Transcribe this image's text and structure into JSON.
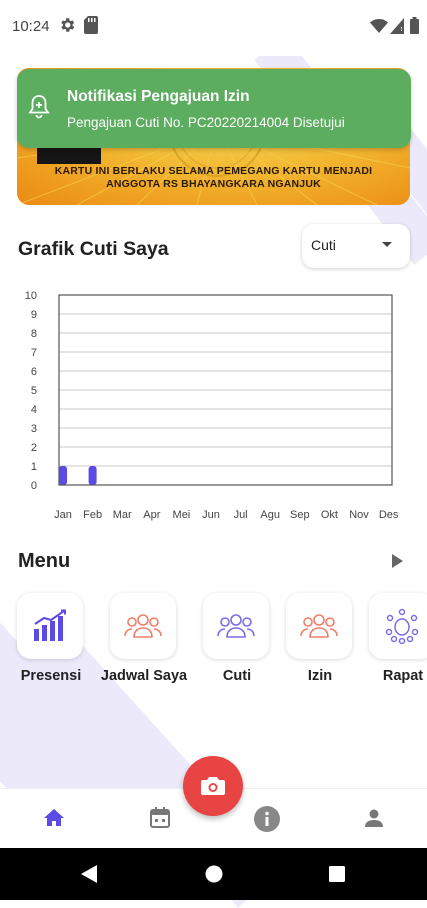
{
  "status_bar": {
    "time": "10:24"
  },
  "id_card": {
    "text_line_1": "KARTU INI BERLAKU SELAMA PEMEGANG KARTU MENJADI",
    "text_line_2": "ANGGOTA RS BHAYANGKARA NGANJUK"
  },
  "notification": {
    "title": "Notifikasi Pengajuan Izin",
    "body": "Pengajuan Cuti No. PC20220214004 Disetujui"
  },
  "chart_section": {
    "title": "Grafik Cuti Saya",
    "dropdown_value": "Cuti"
  },
  "chart_data": {
    "type": "bar",
    "categories": [
      "Jan",
      "Feb",
      "Mar",
      "Apr",
      "Mei",
      "Jun",
      "Jul",
      "Agu",
      "Sep",
      "Okt",
      "Nov",
      "Des"
    ],
    "values": [
      1,
      1,
      0,
      0,
      0,
      0,
      0,
      0,
      0,
      0,
      0,
      0
    ],
    "ylim": [
      0,
      10
    ],
    "yticks": [
      "0",
      "1",
      "2",
      "3",
      "4",
      "5",
      "6",
      "7",
      "8",
      "9",
      "10"
    ],
    "grid": true,
    "bar_color": "#5b4be6"
  },
  "menu": {
    "title": "Menu",
    "items": [
      {
        "label": "Presensi",
        "icon": "bar-chart-icon"
      },
      {
        "label": "Jadwal Saya",
        "icon": "group-icon"
      },
      {
        "label": "Cuti",
        "icon": "group-icon"
      },
      {
        "label": "Izin",
        "icon": "group-icon"
      },
      {
        "label": "Rapat",
        "icon": "meeting-icon"
      }
    ]
  },
  "bottom_nav": {
    "items": [
      "home-icon",
      "calendar-icon",
      "info-icon",
      "profile-icon"
    ],
    "fab_icon": "camera-icon",
    "accent": "#5b4be6",
    "fab_color": "#e94444"
  }
}
